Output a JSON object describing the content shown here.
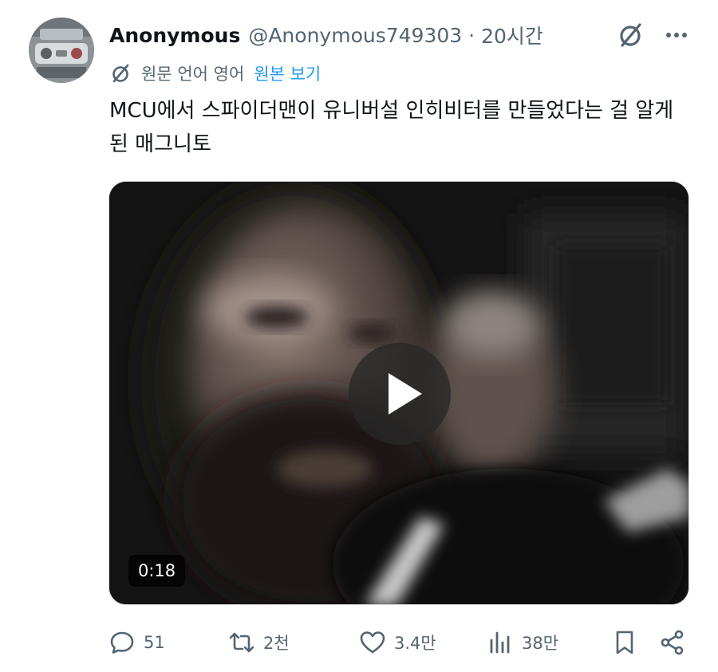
{
  "user": {
    "display_name": "Anonymous",
    "handle": "@Anonymous749303",
    "separator": "·",
    "time": "20시간"
  },
  "translation": {
    "label": "원문 언어 영어",
    "show_original": "원본 보기"
  },
  "tweet": {
    "text": "MCU에서 스파이더맨이 유니버설 인히비터를 만들었다는 걸 알게 된 매그니토"
  },
  "media": {
    "type": "video",
    "duration": "0:18"
  },
  "actions": {
    "reply_count": "51",
    "retweet_count": "2천",
    "like_count": "3.4만",
    "view_count": "38만"
  },
  "icons": {
    "reply": "reply-icon",
    "retweet": "retweet-icon",
    "like": "heart-icon",
    "views": "views-icon",
    "bookmark": "bookmark-icon",
    "share": "share-icon",
    "grok": "grok-icon",
    "more": "more-icon",
    "play": "play-icon"
  },
  "colors": {
    "text": "#0f1419",
    "secondary": "#536471",
    "link": "#1d9bf0",
    "background": "#ffffff"
  }
}
